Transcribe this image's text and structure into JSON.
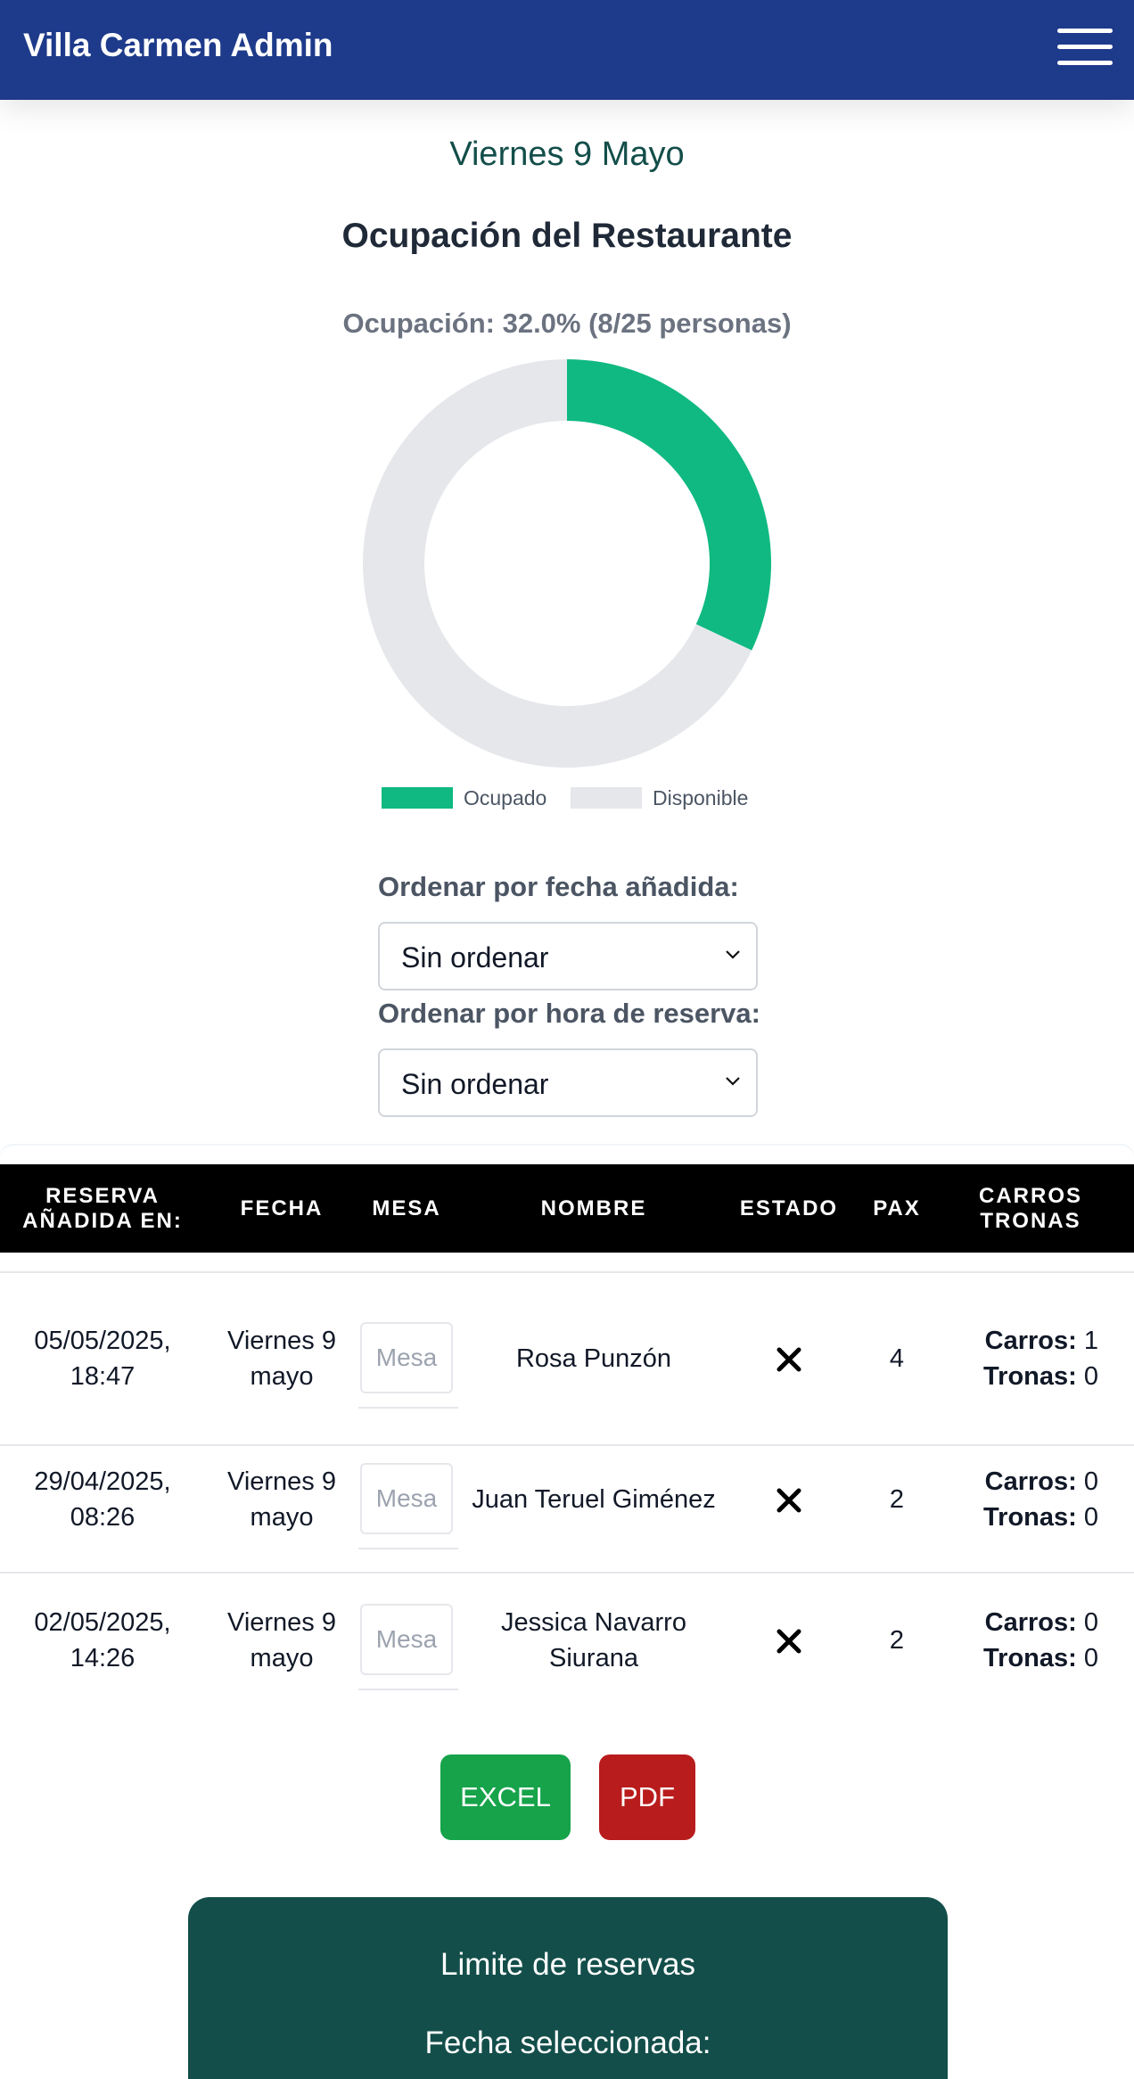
{
  "app": {
    "title": "Villa Carmen Admin"
  },
  "nav": {
    "menu_icon": "hamburger-icon"
  },
  "date_heading": "Viernes 9 Mayo",
  "section_title": "Ocupación del Restaurante",
  "occupancy_label": "Ocupación: 32.0% (8/25 personas)",
  "chart_data": {
    "type": "pie",
    "variant": "doughnut",
    "categories": [
      "Ocupado",
      "Disponible"
    ],
    "values": [
      8,
      17
    ],
    "colors": [
      "#10b981",
      "#e5e7eb"
    ],
    "legend": "bottom"
  },
  "sort": {
    "added_label": "Ordenar por fecha añadida:",
    "added_value": "Sin ordenar",
    "time_label": "Ordenar por hora de reserva:",
    "time_value": "Sin ordenar"
  },
  "table": {
    "headers": [
      "RESERVA\nAÑADIDA EN:",
      "FECHA",
      "MESA",
      "NOMBRE",
      "ESTADO",
      "PAX",
      "CARROS\nTRONAS"
    ],
    "mesa_placeholder": "Mesa",
    "carros_label": "Carros:",
    "tronas_label": "Tronas:",
    "rows": [
      {
        "added_line1": "05/05/2025,",
        "added_line2": "18:47",
        "fecha_line1": "Viernes 9",
        "fecha_line2": "mayo",
        "nombre_line1": "Rosa Punzón",
        "nombre_line2": "",
        "estado_icon": "x-icon",
        "pax": "4",
        "carros": "1",
        "tronas": "0"
      },
      {
        "added_line1": "29/04/2025,",
        "added_line2": "08:26",
        "fecha_line1": "Viernes 9",
        "fecha_line2": "mayo",
        "nombre_line1": "Juan Teruel Giménez",
        "nombre_line2": "",
        "estado_icon": "x-icon",
        "pax": "2",
        "carros": "0",
        "tronas": "0"
      },
      {
        "added_line1": "02/05/2025,",
        "added_line2": "14:26",
        "fecha_line1": "Viernes 9",
        "fecha_line2": "mayo",
        "nombre_line1": "Jessica Navarro",
        "nombre_line2": "Siurana",
        "estado_icon": "x-icon",
        "pax": "2",
        "carros": "0",
        "tronas": "0"
      }
    ]
  },
  "buttons": {
    "excel": "EXCEL",
    "pdf": "PDF"
  },
  "limit_card": {
    "title": "Limite de reservas",
    "subtitle": "Fecha seleccionada:"
  }
}
